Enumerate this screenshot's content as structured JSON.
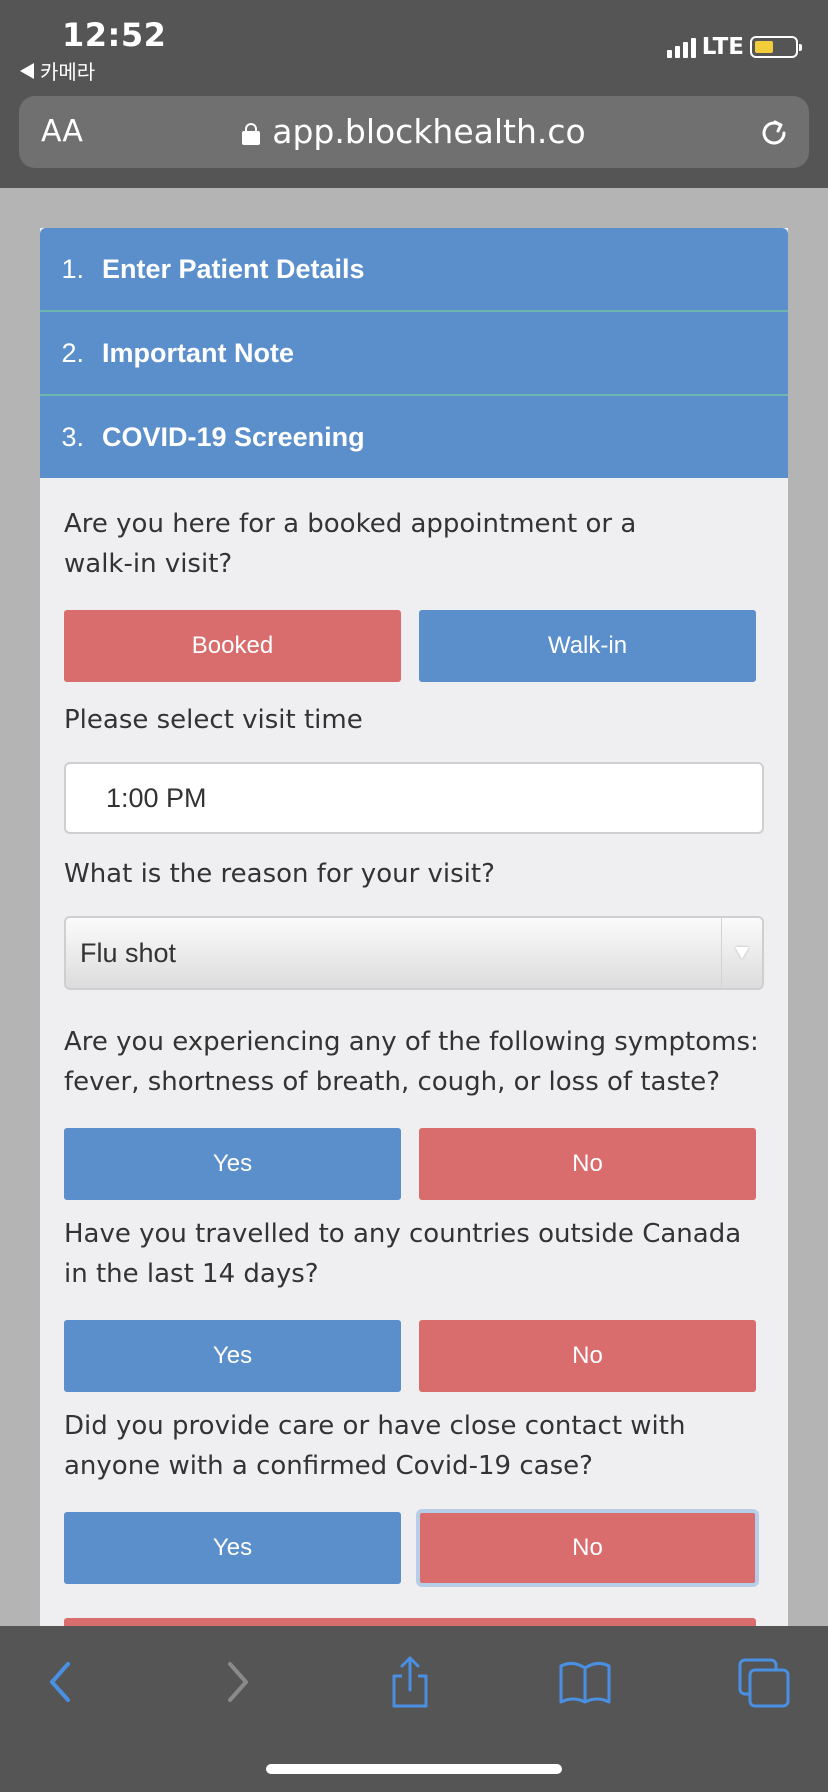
{
  "status": {
    "time": "12:52",
    "back_app": "카메라",
    "network": "LTE"
  },
  "browser": {
    "text_size": "AA",
    "url": "app.blockhealth.co"
  },
  "steps": [
    {
      "number": "1.",
      "label": "Enter Patient Details"
    },
    {
      "number": "2.",
      "label": "Important Note"
    },
    {
      "number": "3.",
      "label": "COVID-19 Screening"
    }
  ],
  "form": {
    "q_visit_type": "Are you here for a booked appointment or a walk-in visit?",
    "btn_booked": "Booked",
    "btn_walkin": "Walk-in",
    "q_visit_time": "Please select visit time",
    "visit_time_value": "1:00 PM",
    "q_reason": "What is the reason for your visit?",
    "reason_value": "Flu shot",
    "q_symptoms": "Are you experiencing any of the following symptoms: fever, shortness of breath, cough, or loss of taste?",
    "q_travel": "Have you travelled to any countries outside Canada in the last 14 days?",
    "q_contact": "Did you provide care or have close contact with anyone with a confirmed Covid-19 case?",
    "yes": "Yes",
    "no": "No"
  },
  "colors": {
    "step_blue": "#5a8fcb",
    "button_red": "#d96c6c",
    "button_blue": "#5a8fcb",
    "toolbar_icon": "#4a90e2"
  },
  "icons": [
    "lock-icon",
    "reload-icon",
    "back-arrow-icon",
    "forward-arrow-icon",
    "share-icon",
    "bookmarks-icon",
    "tabs-icon"
  ]
}
